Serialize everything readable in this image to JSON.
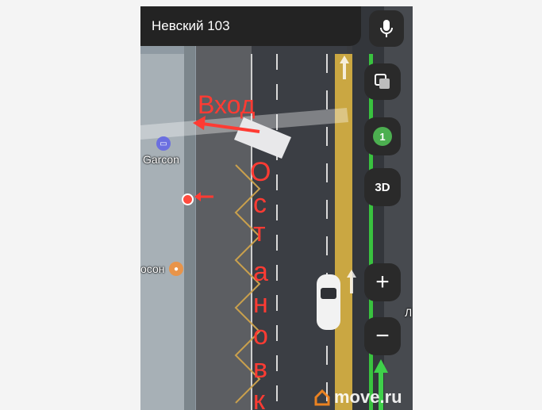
{
  "search": {
    "query": "Невский 103"
  },
  "map": {
    "poi_garcon": "Garcon",
    "poi_left": "осон",
    "right_edge_label": "Л",
    "annotation_entrance": "Вход",
    "annotation_stop_letters": [
      "О",
      "с",
      "т",
      "а",
      "н",
      "о",
      "в",
      "к"
    ],
    "watermark": "move.ru"
  },
  "controls": {
    "traffic_level": "1",
    "view_3d": "3D",
    "zoom_in": "+",
    "zoom_out": "−"
  },
  "icons": {
    "mic": "microphone-icon",
    "layers": "layers-icon",
    "home": "home-logo-icon"
  }
}
